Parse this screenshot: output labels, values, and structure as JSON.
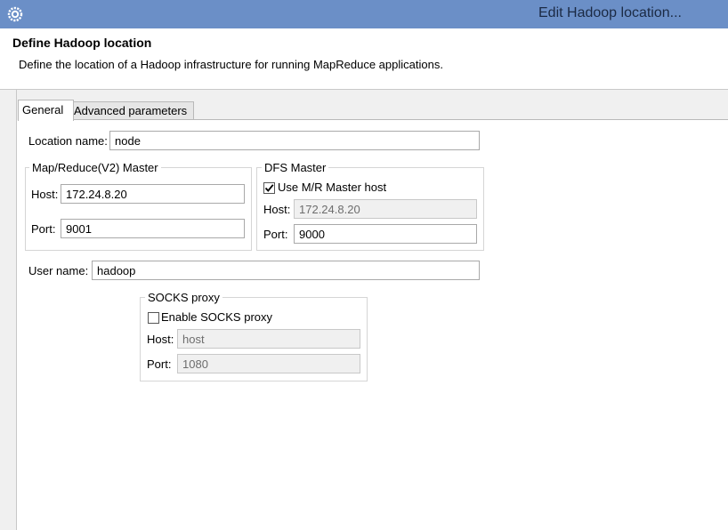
{
  "window": {
    "title": "Edit Hadoop location..."
  },
  "header": {
    "title": "Define Hadoop location",
    "description": "Define the location of a Hadoop infrastructure for running MapReduce applications."
  },
  "tabs": [
    {
      "label": "General",
      "selected": true
    },
    {
      "label": "Advanced parameters",
      "selected": false
    }
  ],
  "general": {
    "location_name_label": "Location name:",
    "location_name_value": "node",
    "mr_master": {
      "legend": "Map/Reduce(V2) Master",
      "host_label": "Host:",
      "host_value": "172.24.8.20",
      "port_label": "Port:",
      "port_value": "9001"
    },
    "dfs_master": {
      "legend": "DFS Master",
      "use_mr_host_label": "Use M/R Master host",
      "use_mr_host_checked": true,
      "host_label": "Host:",
      "host_value": "172.24.8.20",
      "port_label": "Port:",
      "port_value": "9000"
    },
    "user_name_label": "User name:",
    "user_name_value": "hadoop",
    "socks_proxy": {
      "legend": "SOCKS proxy",
      "enable_label": "Enable SOCKS proxy",
      "enable_checked": false,
      "host_label": "Host:",
      "host_value": "host",
      "port_label": "Port:",
      "port_value": "1080"
    }
  },
  "icons": {
    "app": "eclipse-gear-icon",
    "check": "check-icon"
  }
}
